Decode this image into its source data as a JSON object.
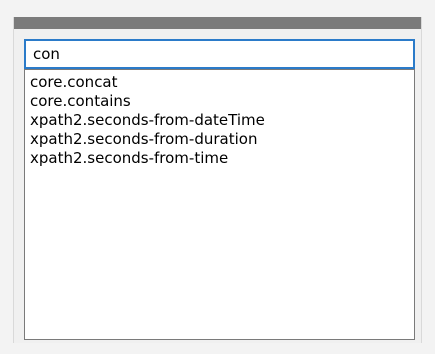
{
  "search": {
    "value": "con"
  },
  "results": [
    "core.concat",
    "core.contains",
    "xpath2.seconds-from-dateTime",
    "xpath2.seconds-from-duration",
    "xpath2.seconds-from-time"
  ],
  "colors": {
    "title_bar": "#7b7b7b",
    "search_border": "#2b7bc9",
    "list_border": "#7a7a7a"
  }
}
